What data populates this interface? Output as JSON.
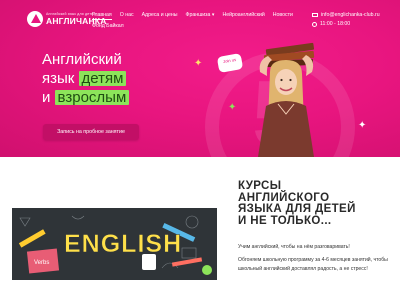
{
  "brand": {
    "tagline": "Английский язык для детей",
    "name": "АНГЛИЧАНКА"
  },
  "nav": {
    "row1": [
      "Главная",
      "О нас",
      "Адреса и цены",
      "Франшиза",
      "Нейроанглийский",
      "Новости"
    ],
    "row2": [
      "Фонд Байкал"
    ],
    "active_index": 0
  },
  "contact": {
    "email": "info@englichanka-club.ru",
    "hours": "11:00 - 18:00"
  },
  "hero": {
    "line1": "Английский",
    "line2_pre": "язык ",
    "line2_hl": "детям",
    "line3_pre": "и ",
    "line3_hl": "взрослым",
    "cta": "Запись на пробное занятие",
    "bubble": "Join us"
  },
  "promo_image": {
    "word": "ENGLISH",
    "book_label": "Verbs"
  },
  "course": {
    "title_lines": [
      "КУРСЫ",
      "АНГЛИЙСКОГО",
      "ЯЗЫКА ДЛЯ ДЕТЕЙ",
      "И НЕ ТОЛЬКО..."
    ],
    "p1": "Учим английский, чтобы на нём разговаривать!",
    "p2": "Обгоняем школьную программу за 4-6 месяцев занятий, чтобы школьный английский доставлял радость, а не стресс!"
  },
  "colors": {
    "brand_pink": "#e8157f",
    "accent_green": "#8de45a",
    "dark_panel": "#2f3438"
  }
}
